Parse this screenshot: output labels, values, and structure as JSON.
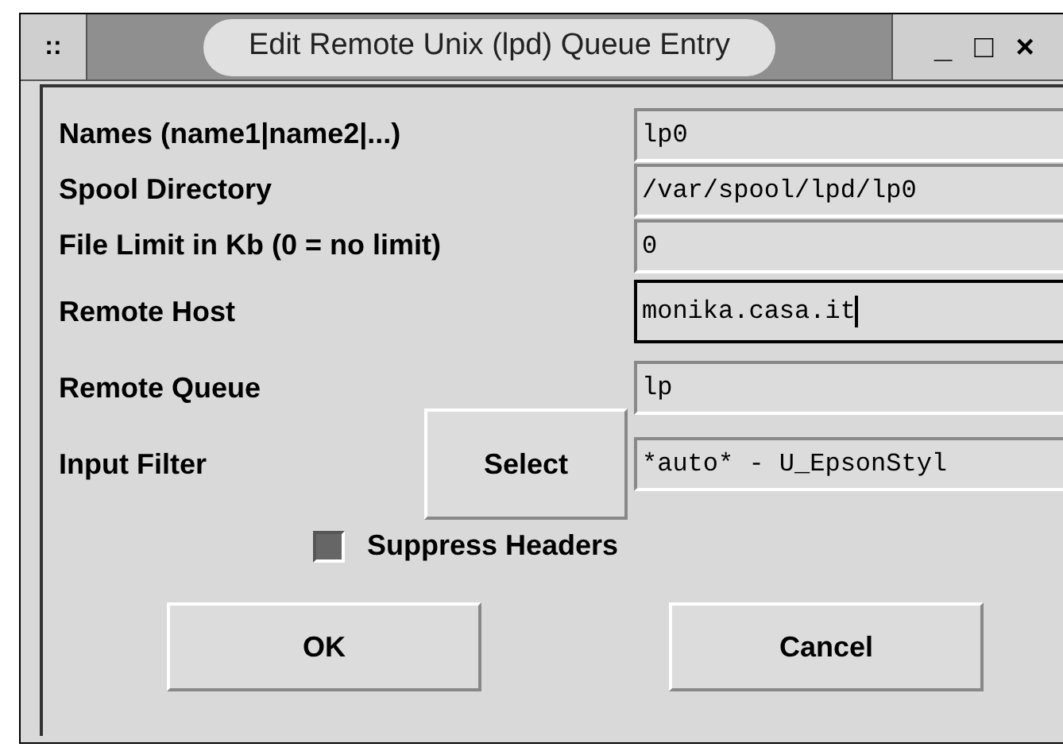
{
  "window": {
    "title": "Edit Remote Unix (lpd) Queue Entry",
    "menu_glyph": "::",
    "controls": [
      "_",
      "□",
      "×"
    ]
  },
  "fields": [
    {
      "label": "Names (name1|name2|...)",
      "value": "lp0",
      "focused": false
    },
    {
      "label": "Spool Directory",
      "value": "/var/spool/lpd/lp0",
      "focused": false
    },
    {
      "label": "File Limit in Kb (0 = no limit)",
      "value": "0",
      "focused": false
    },
    {
      "label": "Remote Host",
      "value": "monika.casa.it",
      "focused": true
    },
    {
      "label": "Remote Queue",
      "value": "lp",
      "focused": false
    },
    {
      "label": "Input Filter",
      "value": "*auto* - U_EpsonStyl",
      "focused": false,
      "button": "Select"
    }
  ],
  "suppress_headers": {
    "label": "Suppress Headers",
    "checked": true
  },
  "buttons": [
    "OK",
    "Cancel"
  ]
}
